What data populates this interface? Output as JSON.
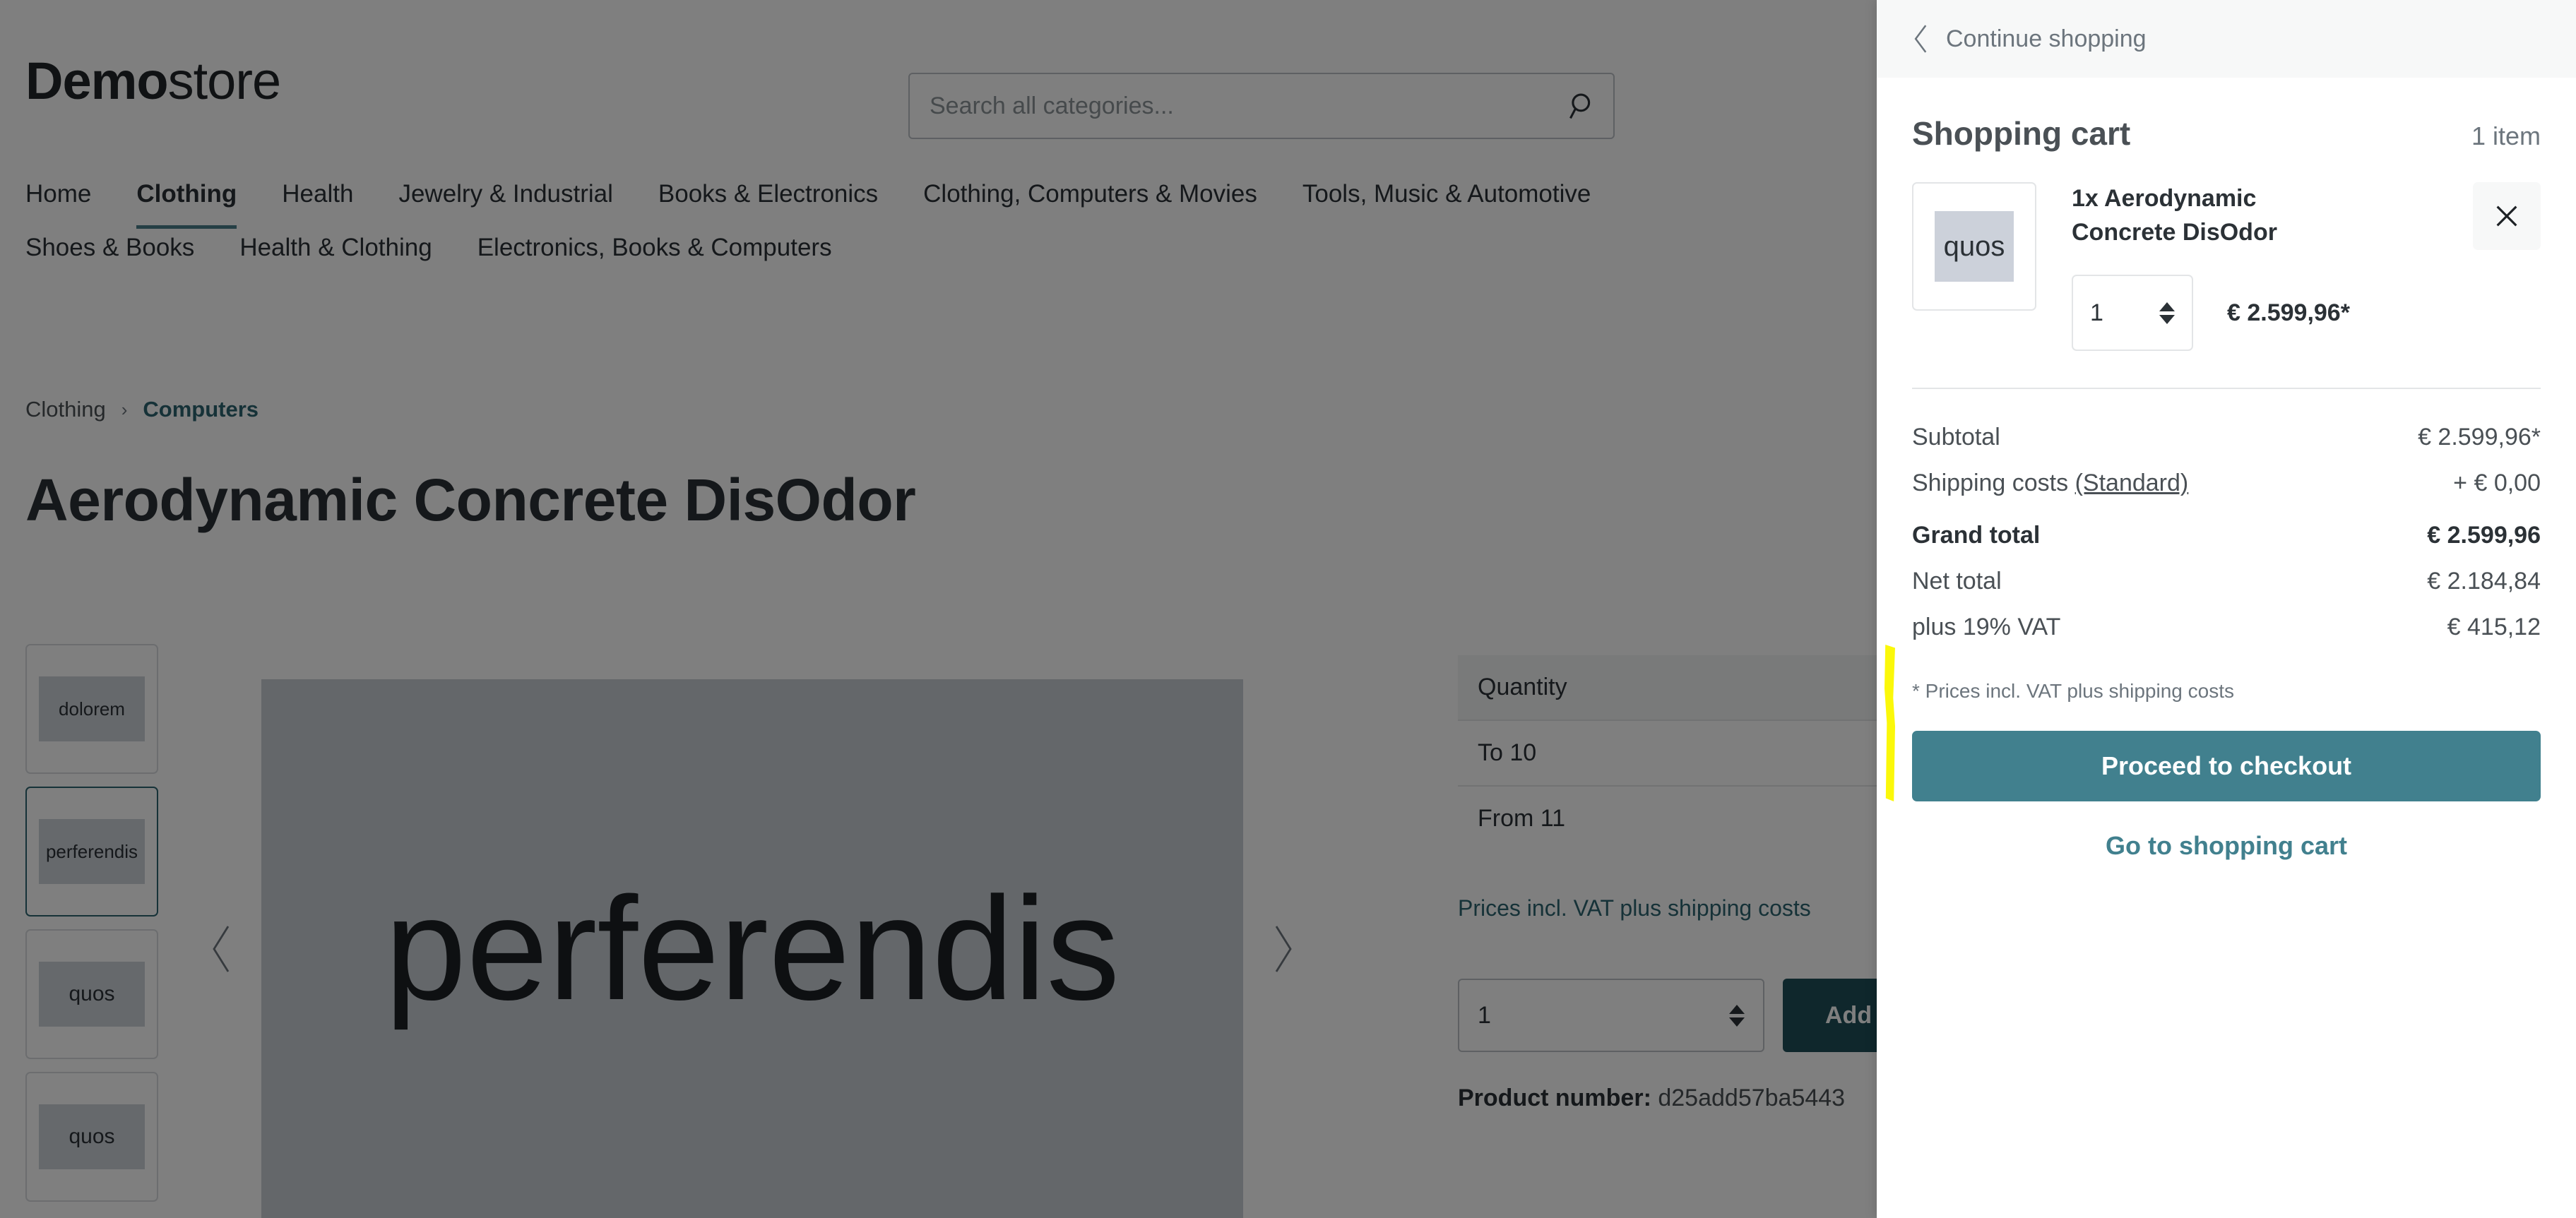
{
  "brand": {
    "bold": "Demo",
    "light": "store"
  },
  "search": {
    "placeholder": "Search all categories...",
    "value": "",
    "icon": "search-icon"
  },
  "nav": {
    "row1": [
      {
        "label": "Home",
        "active": false
      },
      {
        "label": "Clothing",
        "active": true
      },
      {
        "label": "Health",
        "active": false
      },
      {
        "label": "Jewelry & Industrial",
        "active": false
      },
      {
        "label": "Books & Electronics",
        "active": false
      },
      {
        "label": "Clothing, Computers & Movies",
        "active": false
      },
      {
        "label": "Tools, Music & Automotive",
        "active": false
      }
    ],
    "row2": [
      {
        "label": "Shoes & Books",
        "active": false
      },
      {
        "label": "Health & Clothing",
        "active": false
      },
      {
        "label": "Electronics, Books & Computers",
        "active": false
      }
    ]
  },
  "breadcrumb": {
    "parent": "Clothing",
    "separator": "›",
    "current": "Computers"
  },
  "product": {
    "title": "Aerodynamic Concrete DisOdor",
    "gallery_label": "perferendis",
    "prev_icon": "chevron-left-icon",
    "next_icon": "chevron-right-icon",
    "thumbnails": [
      {
        "label": "dolorem",
        "selected": false
      },
      {
        "label": "perferendis",
        "selected": true
      },
      {
        "label": "quos",
        "selected": false
      },
      {
        "label": "quos",
        "selected": false
      }
    ],
    "tier_header": "Quantity",
    "tiers": [
      {
        "range": "To 10"
      },
      {
        "range": "From 11"
      }
    ],
    "tier_note": "Prices incl. VAT plus shipping costs",
    "quantity_value": "1",
    "add_to_cart_label": "Add to shopping cart",
    "product_number_label": "Product number:",
    "product_number_value": "d25add57ba5443"
  },
  "cart": {
    "continue_label": "Continue shopping",
    "back_icon": "chevron-left-icon",
    "title": "Shopping cart",
    "item_count": "1 item",
    "item": {
      "image_label": "quos",
      "name": "1x Aerodynamic Concrete DisOdor",
      "quantity": "1",
      "price": "€ 2.599,96*",
      "remove_icon": "close-icon"
    },
    "totals": [
      {
        "label": "Subtotal",
        "value": "€ 2.599,96*",
        "grand": false,
        "link": null
      },
      {
        "label": "Shipping costs ",
        "value": "+ € 0,00",
        "grand": false,
        "link": "(Standard)"
      },
      {
        "label": "Grand total",
        "value": "€ 2.599,96",
        "grand": true,
        "link": null
      },
      {
        "label": "Net total",
        "value": "€ 2.184,84",
        "grand": false,
        "link": null
      },
      {
        "label": "plus 19% VAT",
        "value": "€ 415,12",
        "grand": false,
        "link": null
      }
    ],
    "vat_note": "* Prices incl. VAT plus shipping costs",
    "checkout_label": "Proceed to checkout",
    "cart_link_label": "Go to shopping cart"
  },
  "colors": {
    "accent_teal": "#41808e",
    "dark_teal": "#1f4f59",
    "link_teal": "#2c6570",
    "highlight_yellow": "#fbf80a",
    "overlay": "rgba(0,0,0,0.5)"
  }
}
